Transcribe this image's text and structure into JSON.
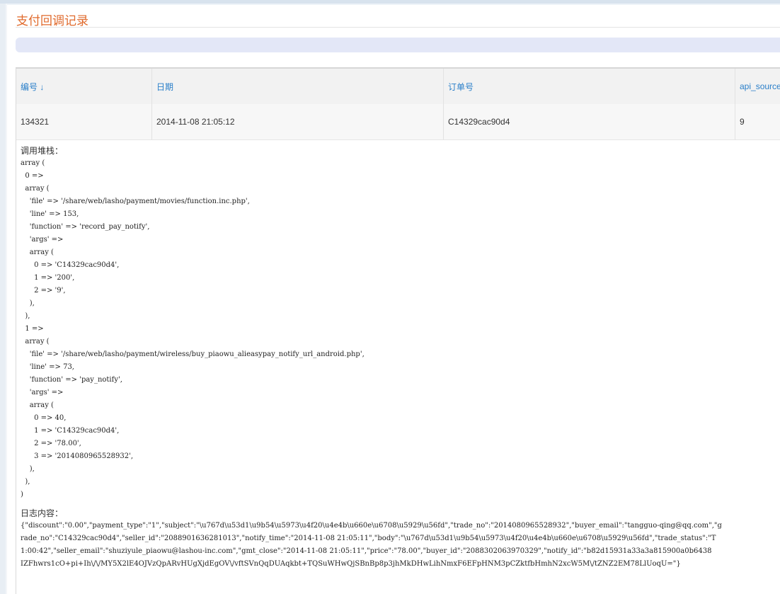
{
  "page": {
    "title": "支付回调记录"
  },
  "table": {
    "columns": [
      "编号 ↓",
      "日期",
      "订单号",
      "api_source"
    ],
    "rows": [
      {
        "id": "134321",
        "date": "2014-11-08 21:05:12",
        "order_no": "C14329cac90d4",
        "api_source": "9"
      }
    ]
  },
  "detail": {
    "stack_label": "调用堆栈：",
    "stack_lines": [
      "array (",
      "  0 =>",
      "  array (",
      "    'file' => '/share/web/lasho/payment/movies/function.inc.php',",
      "    'line' => 153,",
      "    'function' => 'record_pay_notify',",
      "    'args' =>",
      "    array (",
      "      0 => 'C14329cac90d4',",
      "      1 => '200',",
      "      2 => '9',",
      "    ),",
      "  ),",
      "  1 =>",
      "  array (",
      "    'file' => '/share/web/lasho/payment/wireless/buy_piaowu_alieasypay_notify_url_android.php',",
      "    'line' => 73,",
      "    'function' => 'pay_notify',",
      "    'args' =>",
      "    array (",
      "      0 => 40,",
      "      1 => 'C14329cac90d4',",
      "      2 => '78.00',",
      "      3 => '2014080965528932',",
      "    ),",
      "  ),",
      ")"
    ],
    "log_label": "日志内容：",
    "log_lines": [
      "{\"discount\":\"0.00\",\"payment_type\":\"1\",\"subject\":\"\\u767d\\u53d1\\u9b54\\u5973\\u4f20\\u4e4b\\u660e\\u6708\\u5929\\u56fd\",\"trade_no\":\"2014080965528932\",\"buyer_email\":\"tangguo-qing@qq.com\",\"g",
      "rade_no\":\"C14329cac90d4\",\"seller_id\":\"2088901636281013\",\"notify_time\":\"2014-11-08 21:05:11\",\"body\":\"\\u767d\\u53d1\\u9b54\\u5973\\u4f20\\u4e4b\\u660e\\u6708\\u5929\\u56fd\",\"trade_status\":\"T",
      "1:00:42\",\"seller_email\":\"shuziyule_piaowu@lashou-inc.com\",\"gmt_close\":\"2014-11-08 21:05:11\",\"price\":\"78.00\",\"buyer_id\":\"2088302063970329\",\"notify_id\":\"b82d15931a33a3a815900a0b6438",
      "IZFhwrs1cO+pi+Ih\\/\\/MY5X2lE4OJVzQpARvHUgXjdEgOV\\/vftSVnQqDUAqkbt+TQSuWHwQjSBnBp8p3jhMkDHwLihNmxF6EFpHNM3pCZktfbHmhN2xcW5M\\/tZNZ2EM78LlUoqU=\"}"
    ]
  }
}
